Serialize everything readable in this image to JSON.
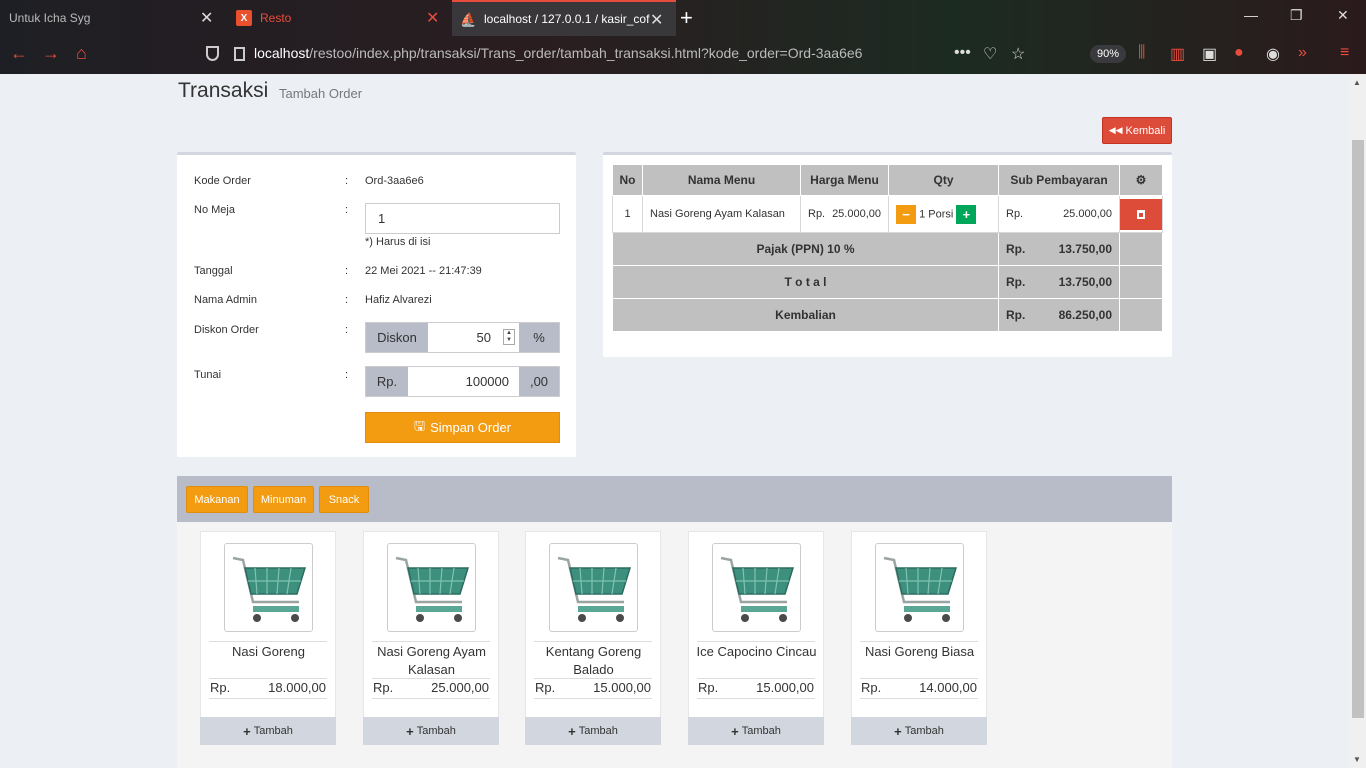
{
  "browser": {
    "tabs": [
      {
        "title": "Untuk Icha Syg"
      },
      {
        "title": "Resto"
      },
      {
        "title": "localhost / 127.0.0.1 / kasir_cof"
      }
    ],
    "url_host": "localhost",
    "url_path": "/restoo/index.php/transaksi/Trans_order/tambah_transaksi.html?kode_order=Ord-3aa6e6",
    "zoom": "90%"
  },
  "page": {
    "title": "Transaksi",
    "subtitle": "Tambah Order",
    "back_label": "Kembali"
  },
  "form": {
    "kode_order_label": "Kode Order",
    "kode_order": "Ord-3aa6e6",
    "no_meja_label": "No Meja",
    "no_meja": "1",
    "no_meja_help": "*) Harus di isi",
    "tanggal_label": "Tanggal",
    "tanggal": "22 Mei 2021 -- 21:47:39",
    "admin_label": "Nama Admin",
    "admin": "Hafiz Alvarezi",
    "diskon_label": "Diskon Order",
    "diskon_addon": "Diskon",
    "diskon": "50",
    "diskon_unit": "%",
    "tunai_label": "Tunai",
    "tunai_prefix": "Rp.",
    "tunai": "100000",
    "tunai_suffix": ",00",
    "save_label": "Simpan Order",
    "colon": ":"
  },
  "order_table": {
    "headers": [
      "No",
      "Nama Menu",
      "Harga Menu",
      "Qty",
      "Sub Pembayaran"
    ],
    "rows": [
      {
        "no": "1",
        "menu": "Nasi Goreng Ayam Kalasan",
        "rp": "Rp.",
        "price": "25.000,00",
        "qty": "1 Porsi",
        "sub_rp": "Rp.",
        "sub": "25.000,00"
      }
    ],
    "pajak_label": "Pajak (PPN) 10 %",
    "pajak_rp": "Rp.",
    "pajak": "13.750,00",
    "total_label": "T o t a l",
    "total_rp": "Rp.",
    "total": "13.750,00",
    "kembalian_label": "Kembalian",
    "kembalian_rp": "Rp.",
    "kembalian": "86.250,00"
  },
  "categories": [
    "Makanan",
    "Minuman",
    "Snack"
  ],
  "menu_items": [
    {
      "name": "Nasi Goreng",
      "rp": "Rp.",
      "price": "18.000,00",
      "btn": "Tambah"
    },
    {
      "name": "Nasi Goreng Ayam Kalasan",
      "rp": "Rp.",
      "price": "25.000,00",
      "btn": "Tambah"
    },
    {
      "name": "Kentang Goreng Balado",
      "rp": "Rp.",
      "price": "15.000,00",
      "btn": "Tambah"
    },
    {
      "name": "Ice Capocino Cincau",
      "rp": "Rp.",
      "price": "15.000,00",
      "btn": "Tambah"
    },
    {
      "name": "Nasi Goreng Biasa",
      "rp": "Rp.",
      "price": "14.000,00",
      "btn": "Tambah"
    }
  ],
  "colors": {
    "orange": "#f39c12",
    "red": "#dd4b39",
    "green": "#00a65a",
    "gray": "#b8bcc9"
  }
}
